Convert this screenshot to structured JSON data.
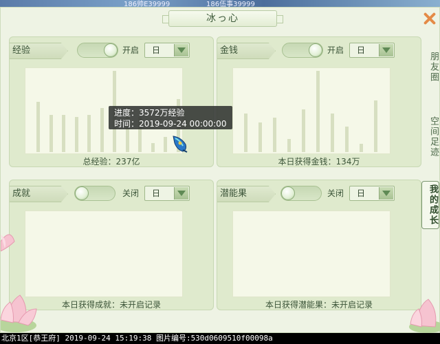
{
  "top_strip": {
    "names": [
      "186帅E39999",
      "186伍事39999"
    ]
  },
  "window": {
    "title": "冰っ心"
  },
  "side_tabs": [
    {
      "label": "朋友圈",
      "active": false
    },
    {
      "label": "空间足迹",
      "active": false
    },
    {
      "label": "我的成长",
      "active": true
    }
  ],
  "panels": {
    "exp": {
      "label": "经验",
      "toggle_state": "开启",
      "period": "日",
      "caption": "总经验：237亿",
      "chart_data": {
        "type": "bar",
        "values": [
          23,
          17,
          17,
          16,
          17,
          20,
          37,
          19,
          16,
          4,
          7,
          24
        ]
      }
    },
    "money": {
      "label": "金钱",
      "toggle_state": "开启",
      "period": "日",
      "caption": "本日获得金钱：134万",
      "chart_data": {
        "type": "bar",
        "values": [
          18,
          14,
          16,
          6,
          20,
          38,
          18,
          12,
          4,
          24
        ]
      }
    },
    "achievement": {
      "label": "成就",
      "toggle_state": "关闭",
      "period": "日",
      "caption": "本日获得成就：未开启记录"
    },
    "potential": {
      "label": "潜能果",
      "toggle_state": "关闭",
      "period": "日",
      "caption": "本日获得潜能果：未开启记录"
    }
  },
  "tooltip": {
    "line1": "进度：3572万经验",
    "line2": "时间：2019-09-24 00:00:00"
  },
  "status_bar": "北京1区[恭王府] 2019-09-24 15:19:38 图片编号:530d0609510f00098a"
}
